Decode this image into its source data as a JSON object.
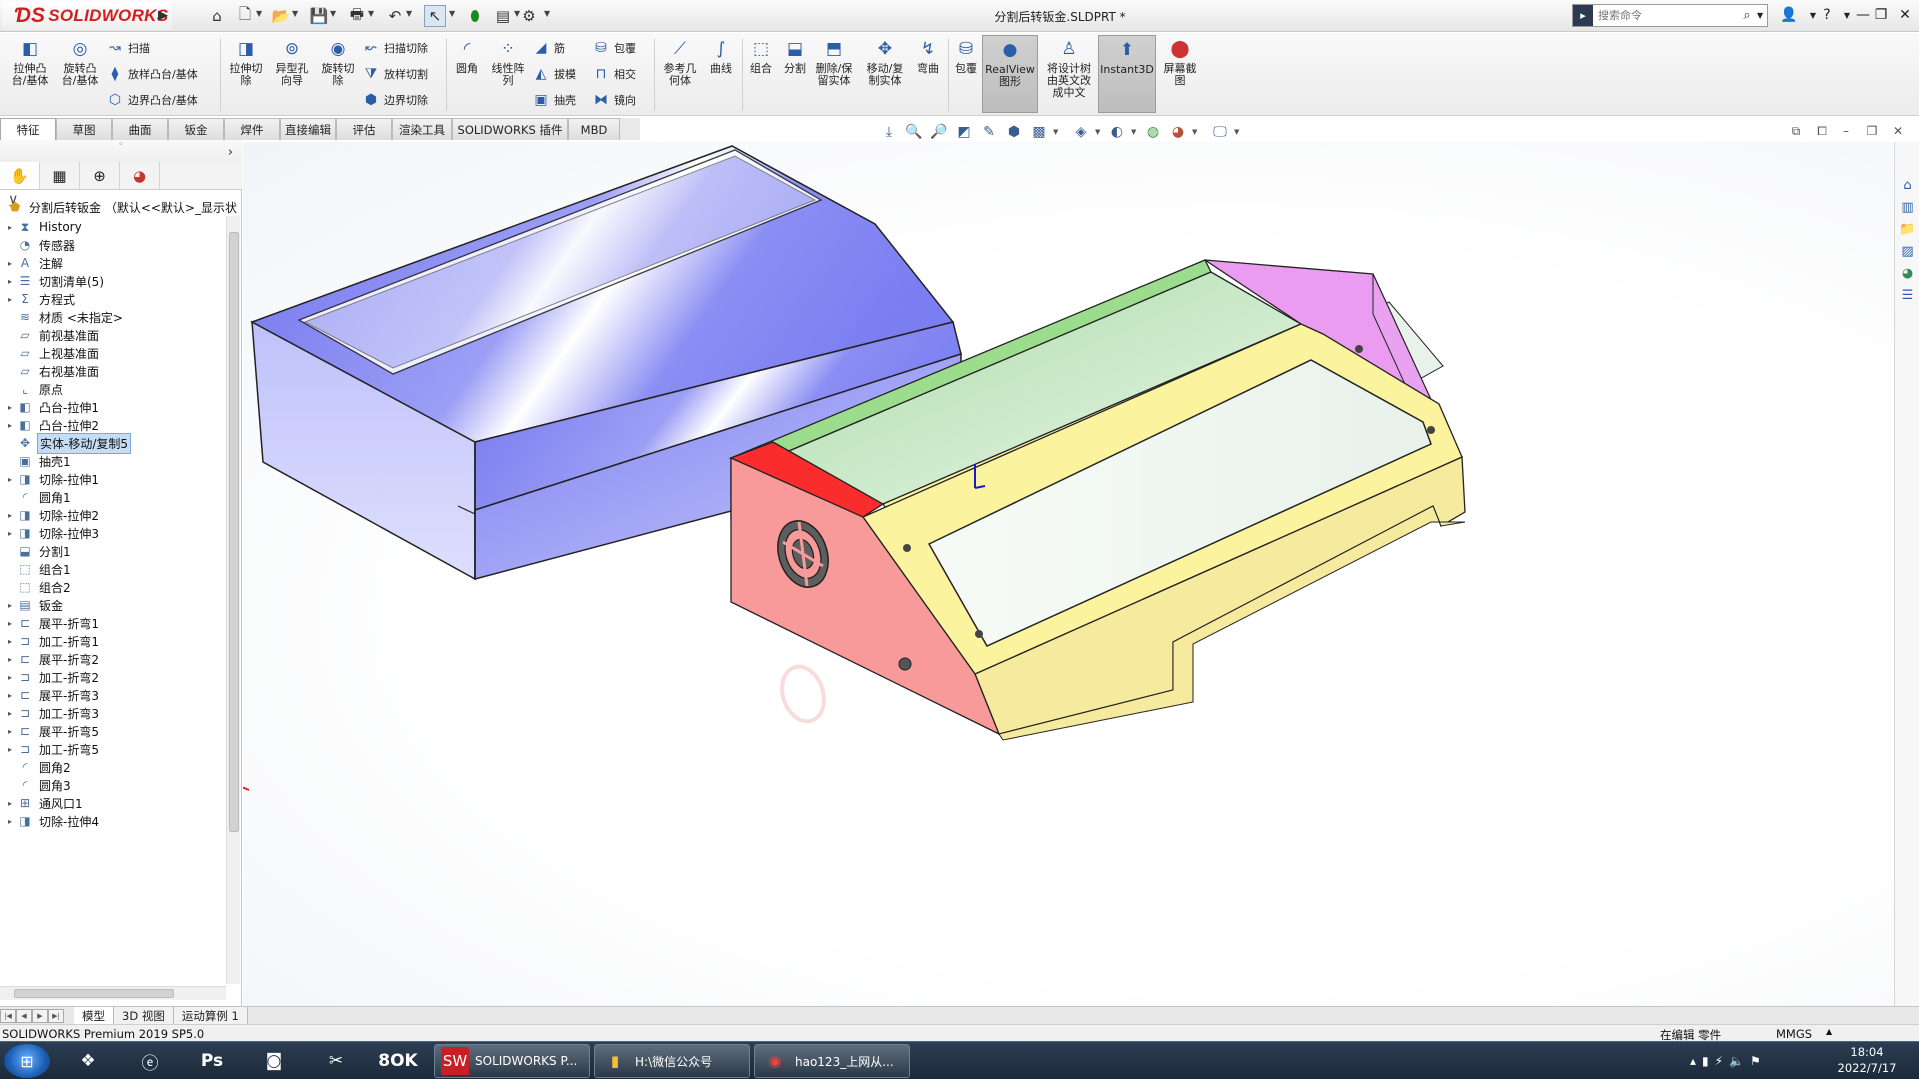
{
  "app": {
    "logo_text": "SOLIDWORKS",
    "doc_title": "分割后转钣金.SLDPRT *",
    "search_placeholder": "搜索命令"
  },
  "colors": {
    "brand": "#d11f1f",
    "selection": "#c6dcf3",
    "body_blue": "#7a7cf3",
    "face_green": "#a7dda1",
    "face_pink": "#ea9cf0",
    "face_yellow": "#fbf4a0",
    "face_red": "#f59c9a"
  },
  "quickaccess": [
    "home-icon",
    "new-icon",
    "open-icon",
    "save-icon",
    "print-icon",
    "undo-icon",
    "select-icon",
    "rebuild-icon",
    "file-props-icon",
    "options-icon"
  ],
  "toolbar": {
    "extrude_boss": "拉伸凸\n台/基体",
    "revolve_boss": "旋转凸\n台/基体",
    "sweep": "扫描",
    "loft": "放样凸台/基体",
    "boundary": "边界凸台/基体",
    "extrude_cut": "拉伸切\n除",
    "hole_wizard": "异型孔\n向导",
    "revolve_cut": "旋转切\n除",
    "swept_cut": "扫描切除",
    "lofted_cut": "放样切割",
    "boundary_cut": "边界切除",
    "fillet": "圆角",
    "linear_pattern": "线性阵\n列",
    "rib": "筋",
    "draft": "拔模",
    "shell": "抽壳",
    "wrap": "包覆",
    "intersect": "相交",
    "mirror": "镜向",
    "ref_geometry": "参考几\n何体",
    "curves": "曲线",
    "combine": "组合",
    "split": "分割",
    "delete_keep": "删除/保\n留实体",
    "move_copy": "移动/复\n制实体",
    "flex": "弯曲",
    "wrap2": "包覆",
    "realview": "RealView\n图形",
    "translate_tree": "将设计树\n由英文改\n成中文",
    "instant3d": "Instant3D",
    "screenshot": "屏幕截\n图"
  },
  "tabs": [
    "特征",
    "草图",
    "曲面",
    "钣金",
    "焊件",
    "直接编辑",
    "评估",
    "渲染工具",
    "SOLIDWORKS 插件",
    "MBD"
  ],
  "tree": {
    "root": "分割后转钣金 （默认<<默认>_显示状",
    "items": [
      {
        "label": "History",
        "icon": "history-icon",
        "exp": true
      },
      {
        "label": "传感器",
        "icon": "sensor-icon",
        "exp": false
      },
      {
        "label": "注解",
        "icon": "annotation-icon",
        "exp": true
      },
      {
        "label": "切割清单(5)",
        "icon": "cutlist-icon",
        "exp": true
      },
      {
        "label": "方程式",
        "icon": "equation-icon",
        "exp": true
      },
      {
        "label": "材质 <未指定>",
        "icon": "material-icon",
        "exp": false
      },
      {
        "label": "前视基准面",
        "icon": "plane-icon",
        "exp": false
      },
      {
        "label": "上视基准面",
        "icon": "plane-icon",
        "exp": false
      },
      {
        "label": "右视基准面",
        "icon": "plane-icon",
        "exp": false
      },
      {
        "label": "原点",
        "icon": "origin-icon",
        "exp": false
      },
      {
        "label": "凸台-拉伸1",
        "icon": "extrude-icon",
        "exp": true
      },
      {
        "label": "凸台-拉伸2",
        "icon": "extrude-icon",
        "exp": true
      },
      {
        "label": "实体-移动/复制5",
        "icon": "move-body-icon",
        "exp": false,
        "selected": true
      },
      {
        "label": "抽壳1",
        "icon": "shell-icon",
        "exp": false
      },
      {
        "label": "切除-拉伸1",
        "icon": "cut-icon",
        "exp": true
      },
      {
        "label": "圆角1",
        "icon": "fillet-icon",
        "exp": false
      },
      {
        "label": "切除-拉伸2",
        "icon": "cut-icon",
        "exp": true
      },
      {
        "label": "切除-拉伸3",
        "icon": "cut-icon",
        "exp": true
      },
      {
        "label": "分割1",
        "icon": "split-icon",
        "exp": false
      },
      {
        "label": "组合1",
        "icon": "combine-icon",
        "exp": false
      },
      {
        "label": "组合2",
        "icon": "combine-icon",
        "exp": false
      },
      {
        "label": "钣金",
        "icon": "sheetmetal-icon",
        "exp": true
      },
      {
        "label": "展平-折弯1",
        "icon": "unfold-icon",
        "exp": true
      },
      {
        "label": "加工-折弯1",
        "icon": "process-bend-icon",
        "exp": true
      },
      {
        "label": "展平-折弯2",
        "icon": "unfold-icon",
        "exp": true
      },
      {
        "label": "加工-折弯2",
        "icon": "process-bend-icon",
        "exp": true
      },
      {
        "label": "展平-折弯3",
        "icon": "unfold-icon",
        "exp": true
      },
      {
        "label": "加工-折弯3",
        "icon": "process-bend-icon",
        "exp": true
      },
      {
        "label": "展平-折弯5",
        "icon": "unfold-icon",
        "exp": true
      },
      {
        "label": "加工-折弯5",
        "icon": "process-bend-icon",
        "exp": true
      },
      {
        "label": "圆角2",
        "icon": "fillet-icon",
        "exp": false
      },
      {
        "label": "圆角3",
        "icon": "fillet-icon",
        "exp": false
      },
      {
        "label": "通风口1",
        "icon": "vent-icon",
        "exp": true
      },
      {
        "label": "切除-拉伸4",
        "icon": "cut-icon",
        "exp": true
      }
    ]
  },
  "model_tabs": [
    "模型",
    "3D 视图",
    "运动算例 1"
  ],
  "status": {
    "product": "SOLIDWORKS Premium 2019 SP5.0",
    "mode": "在编辑 零件",
    "units": "MMGS"
  },
  "taskbar": {
    "apps": [
      "qq-icon",
      "browser-icon",
      "photoshop-icon",
      "media-icon",
      "tool-icon",
      "ok-icon"
    ],
    "windows": [
      {
        "label": "SOLIDWORKS P...",
        "icon": "solidworks-icon"
      },
      {
        "label": "H:\\微信公众号",
        "icon": "folder-icon"
      },
      {
        "label": "hao123_上网从...",
        "icon": "chrome-icon"
      }
    ],
    "time": "18:04",
    "date": "2022/7/17"
  }
}
